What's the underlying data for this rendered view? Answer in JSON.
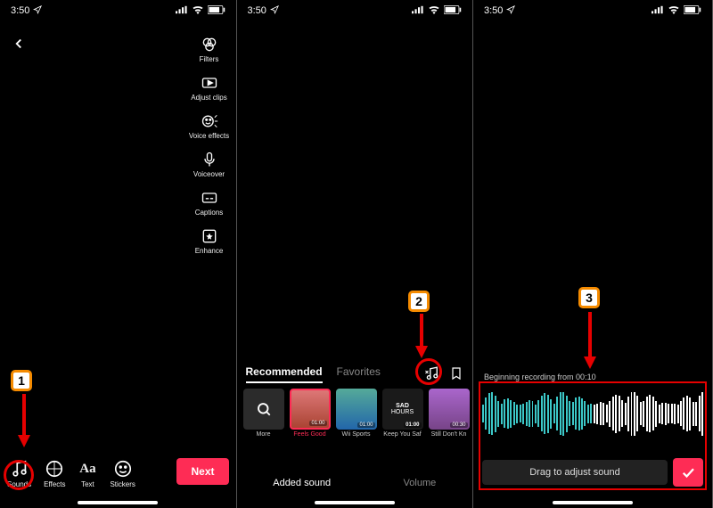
{
  "status": {
    "time": "3:50",
    "location_icon": "⌖"
  },
  "screen1": {
    "side_tools": [
      {
        "name": "filters",
        "label": "Filters"
      },
      {
        "name": "adjust-clips",
        "label": "Adjust clips"
      },
      {
        "name": "voice-effects",
        "label": "Voice effects"
      },
      {
        "name": "voiceover",
        "label": "Voiceover"
      },
      {
        "name": "captions",
        "label": "Captions"
      },
      {
        "name": "enhance",
        "label": "Enhance"
      }
    ],
    "bottom_tools": [
      {
        "name": "sounds",
        "label": "Sounds"
      },
      {
        "name": "effects",
        "label": "Effects"
      },
      {
        "name": "text",
        "label": "Text"
      },
      {
        "name": "stickers",
        "label": "Stickers"
      }
    ],
    "next": "Next",
    "annotation": "1"
  },
  "screen2": {
    "tabs": {
      "recommended": "Recommended",
      "favorites": "Favorites"
    },
    "sounds": [
      {
        "name": "more",
        "label": "More",
        "dur": "",
        "color": "#2b2b2b"
      },
      {
        "name": "feels-good",
        "label": "Feels Good",
        "dur": "01:00",
        "color": "#c75c2e",
        "selected": true
      },
      {
        "name": "wii-sports",
        "label": "Wii Sports",
        "dur": "01:00",
        "color": "#2f6fc7"
      },
      {
        "name": "keep-you-saf",
        "label": "Keep You Saf",
        "dur": "01:00",
        "color": "#2b2b2b",
        "text": "SAD\nHOURS"
      },
      {
        "name": "still-dont-kn",
        "label": "Still Don't Kn",
        "dur": "00:30",
        "color": "#8a4aa0"
      }
    ],
    "bottom_tabs": {
      "added": "Added sound",
      "volume": "Volume"
    },
    "annotation": "2"
  },
  "screen3": {
    "recording_text": "Beginning recording from 00:10",
    "drag_label": "Drag to adjust sound",
    "annotation": "3"
  }
}
